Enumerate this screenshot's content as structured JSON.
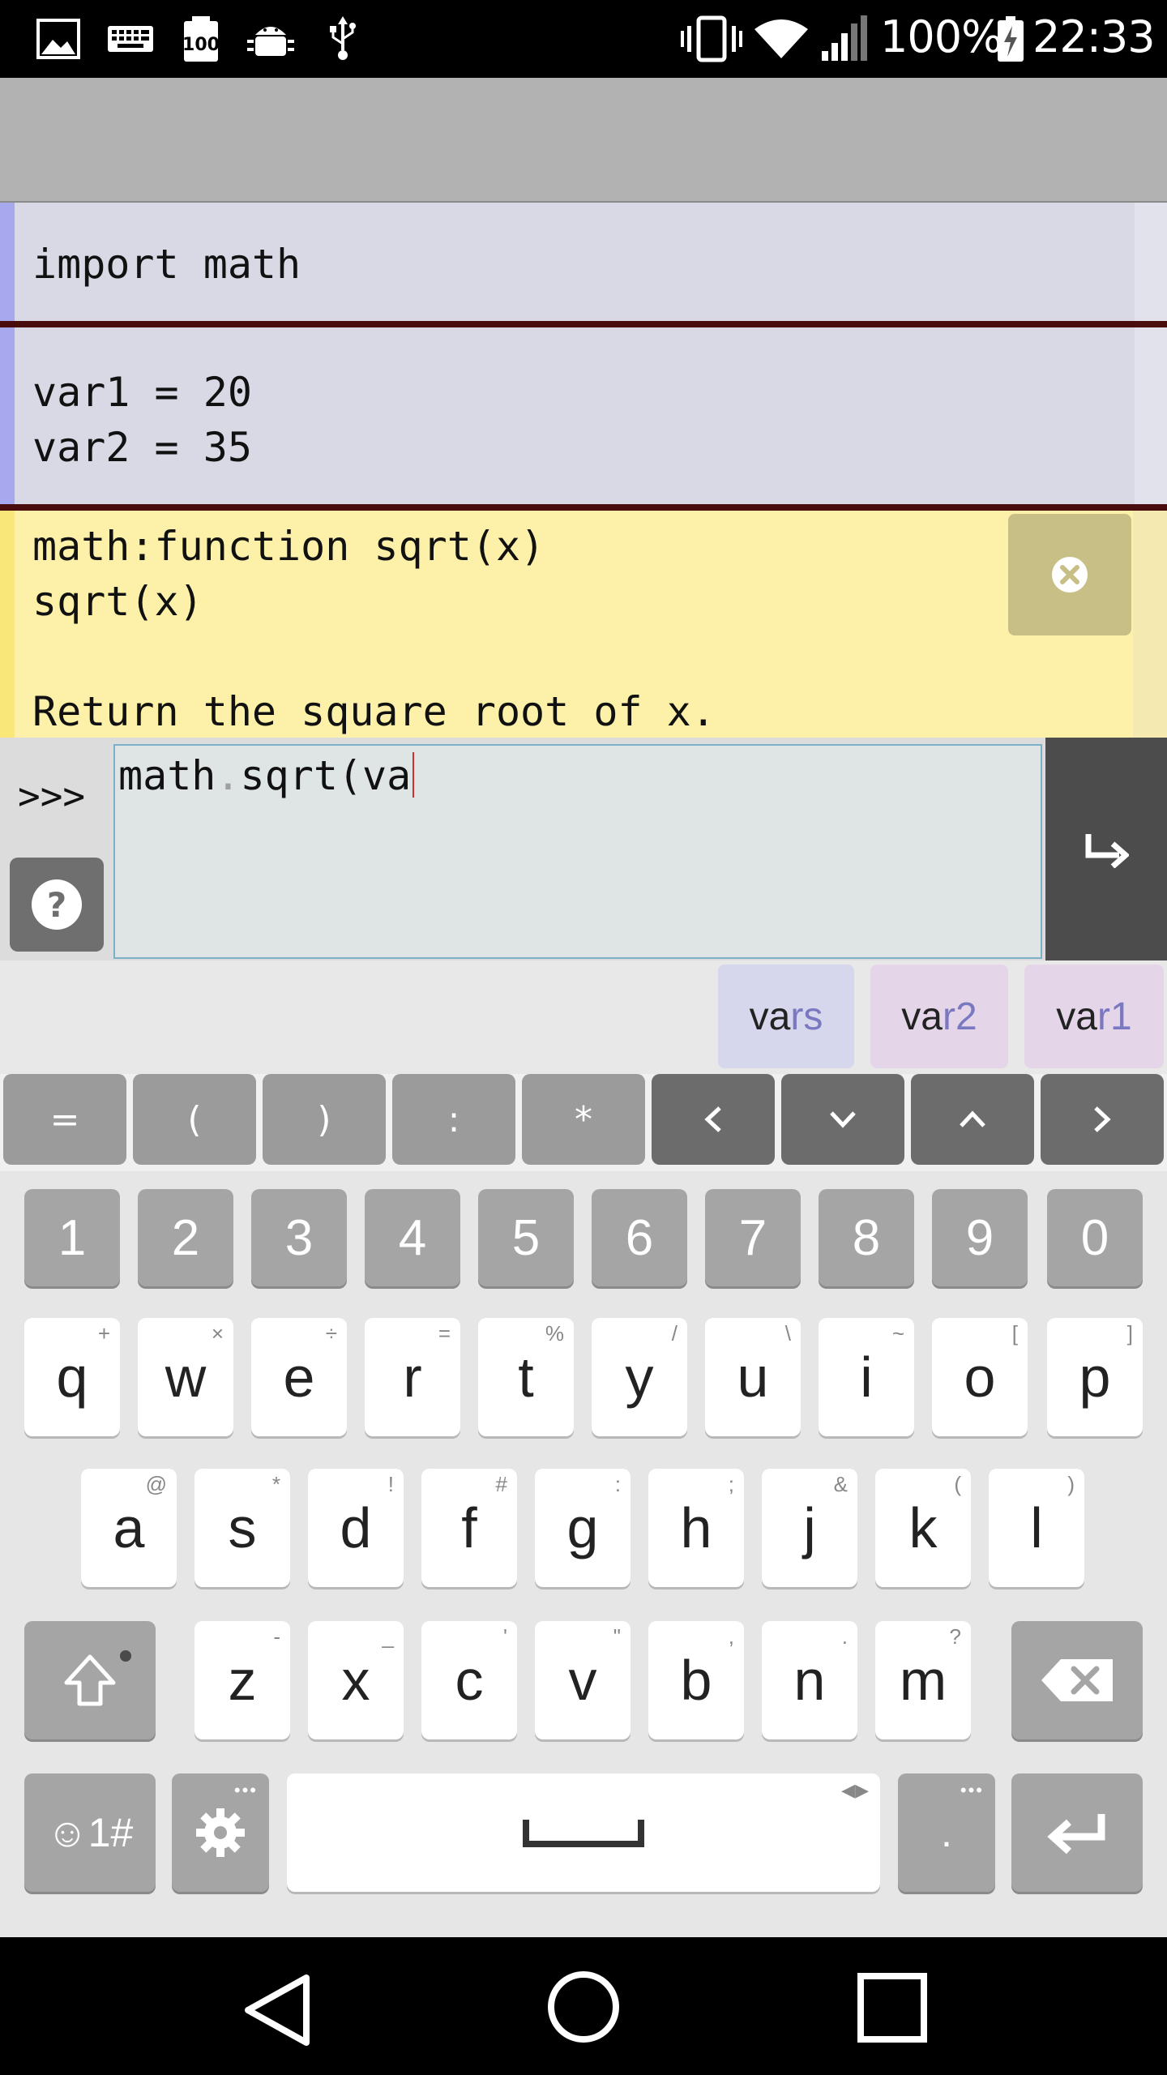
{
  "status_bar": {
    "battery": "100%",
    "time": "22:33",
    "icons": [
      "gallery-icon",
      "keyboard-icon",
      "battery-100-notification-icon",
      "android-debug-icon",
      "usb-icon",
      "vibrate-icon",
      "wifi-icon",
      "signal-icon",
      "battery-charging-icon"
    ]
  },
  "history": {
    "cells": [
      {
        "code": "import math"
      },
      {
        "code": "var1 = 20\nvar2 = 35"
      }
    ]
  },
  "doc_popup": {
    "text": "math:function sqrt(x)\nsqrt(x)\n\nReturn the square root of x.",
    "close_icon": "close-circle-icon"
  },
  "input": {
    "prompt": ">>>",
    "code_before_dot": "math",
    "code_dot": ".",
    "code_after_dot": "sqrt(va",
    "help_icon": "help-icon",
    "run_icon": "enter-arrow-icon"
  },
  "suggestions": [
    {
      "prefix": "va",
      "suffix": "rs"
    },
    {
      "prefix": "va",
      "suffix": "r2"
    },
    {
      "prefix": "va",
      "suffix": "r1"
    }
  ],
  "symbol_row": [
    "=",
    "(",
    ")",
    ":",
    "*",
    "‹",
    "⌄",
    "⌃",
    "›"
  ],
  "keyboard": {
    "numbers": [
      "1",
      "2",
      "3",
      "4",
      "5",
      "6",
      "7",
      "8",
      "9",
      "0"
    ],
    "row1": [
      {
        "k": "q",
        "h": "+"
      },
      {
        "k": "w",
        "h": "×"
      },
      {
        "k": "e",
        "h": "÷"
      },
      {
        "k": "r",
        "h": "="
      },
      {
        "k": "t",
        "h": "%"
      },
      {
        "k": "y",
        "h": "/"
      },
      {
        "k": "u",
        "h": "\\"
      },
      {
        "k": "i",
        "h": "~"
      },
      {
        "k": "o",
        "h": "["
      },
      {
        "k": "p",
        "h": "]"
      }
    ],
    "row2": [
      {
        "k": "a",
        "h": "@"
      },
      {
        "k": "s",
        "h": "*"
      },
      {
        "k": "d",
        "h": "!"
      },
      {
        "k": "f",
        "h": "#"
      },
      {
        "k": "g",
        "h": ":"
      },
      {
        "k": "h",
        "h": ";"
      },
      {
        "k": "j",
        "h": "&"
      },
      {
        "k": "k",
        "h": "("
      },
      {
        "k": "l",
        "h": ")"
      }
    ],
    "row3": [
      {
        "k": "z",
        "h": "-"
      },
      {
        "k": "x",
        "h": "_"
      },
      {
        "k": "c",
        "h": "'"
      },
      {
        "k": "v",
        "h": "\""
      },
      {
        "k": "b",
        "h": ","
      },
      {
        "k": "n",
        "h": "."
      },
      {
        "k": "m",
        "h": "?"
      }
    ],
    "emoji_label": "☺1#",
    "period": "."
  },
  "colors": {
    "cell_bg": "#d9d9e6",
    "cell_accent": "#a8a8ee",
    "doc_bg": "#fdf1a9",
    "separator": "#4a0d0d",
    "suggestion_bg_primary": "#d6d6ec",
    "suggestion_bg_secondary": "#e4d6e8"
  }
}
